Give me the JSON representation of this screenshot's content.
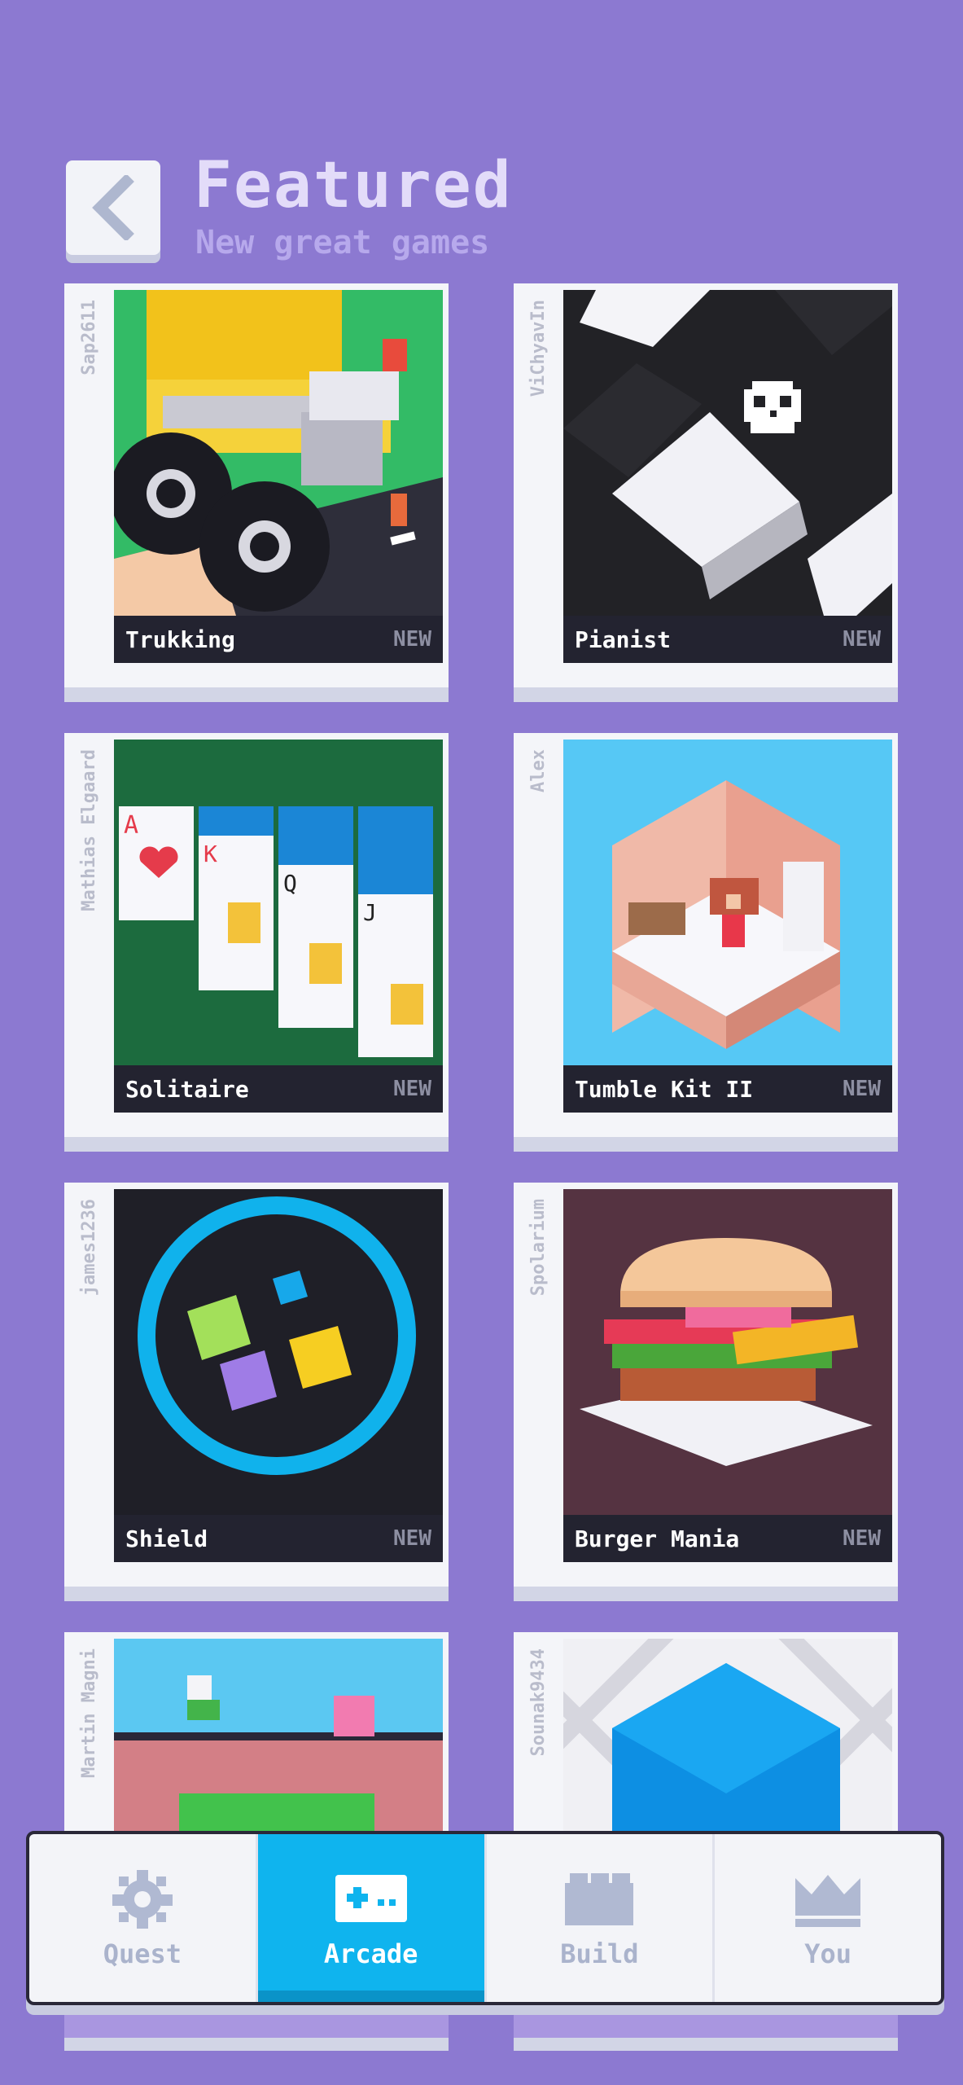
{
  "header": {
    "title": "Featured",
    "subtitle": "New great games"
  },
  "games": [
    {
      "name": "Trukking",
      "author": "Sap2611",
      "badge": "NEW"
    },
    {
      "name": "Pianist",
      "author": "ViChyavIn",
      "badge": "NEW"
    },
    {
      "name": "Solitaire",
      "author": "Mathias Elgaard",
      "badge": "NEW"
    },
    {
      "name": "Tumble Kit II",
      "author": "Alex",
      "badge": "NEW"
    },
    {
      "name": "Shield",
      "author": "james1236",
      "badge": "NEW"
    },
    {
      "name": "Burger Mania",
      "author": "Spolarium",
      "badge": "NEW"
    },
    {
      "name": "",
      "author": "Martin Magni",
      "badge": ""
    },
    {
      "name": "",
      "author": "Sounak9434",
      "badge": ""
    }
  ],
  "tabs": [
    {
      "label": "Quest",
      "icon": "gear-icon",
      "active": false
    },
    {
      "label": "Arcade",
      "icon": "gamepad-icon",
      "active": true
    },
    {
      "label": "Build",
      "icon": "brick-icon",
      "active": false
    },
    {
      "label": "You",
      "icon": "crown-icon",
      "active": false
    }
  ],
  "colors": {
    "background": "#8c79d1",
    "accent": "#0fb4ee",
    "card": "#f4f5f9",
    "label_bar": "#232330"
  }
}
